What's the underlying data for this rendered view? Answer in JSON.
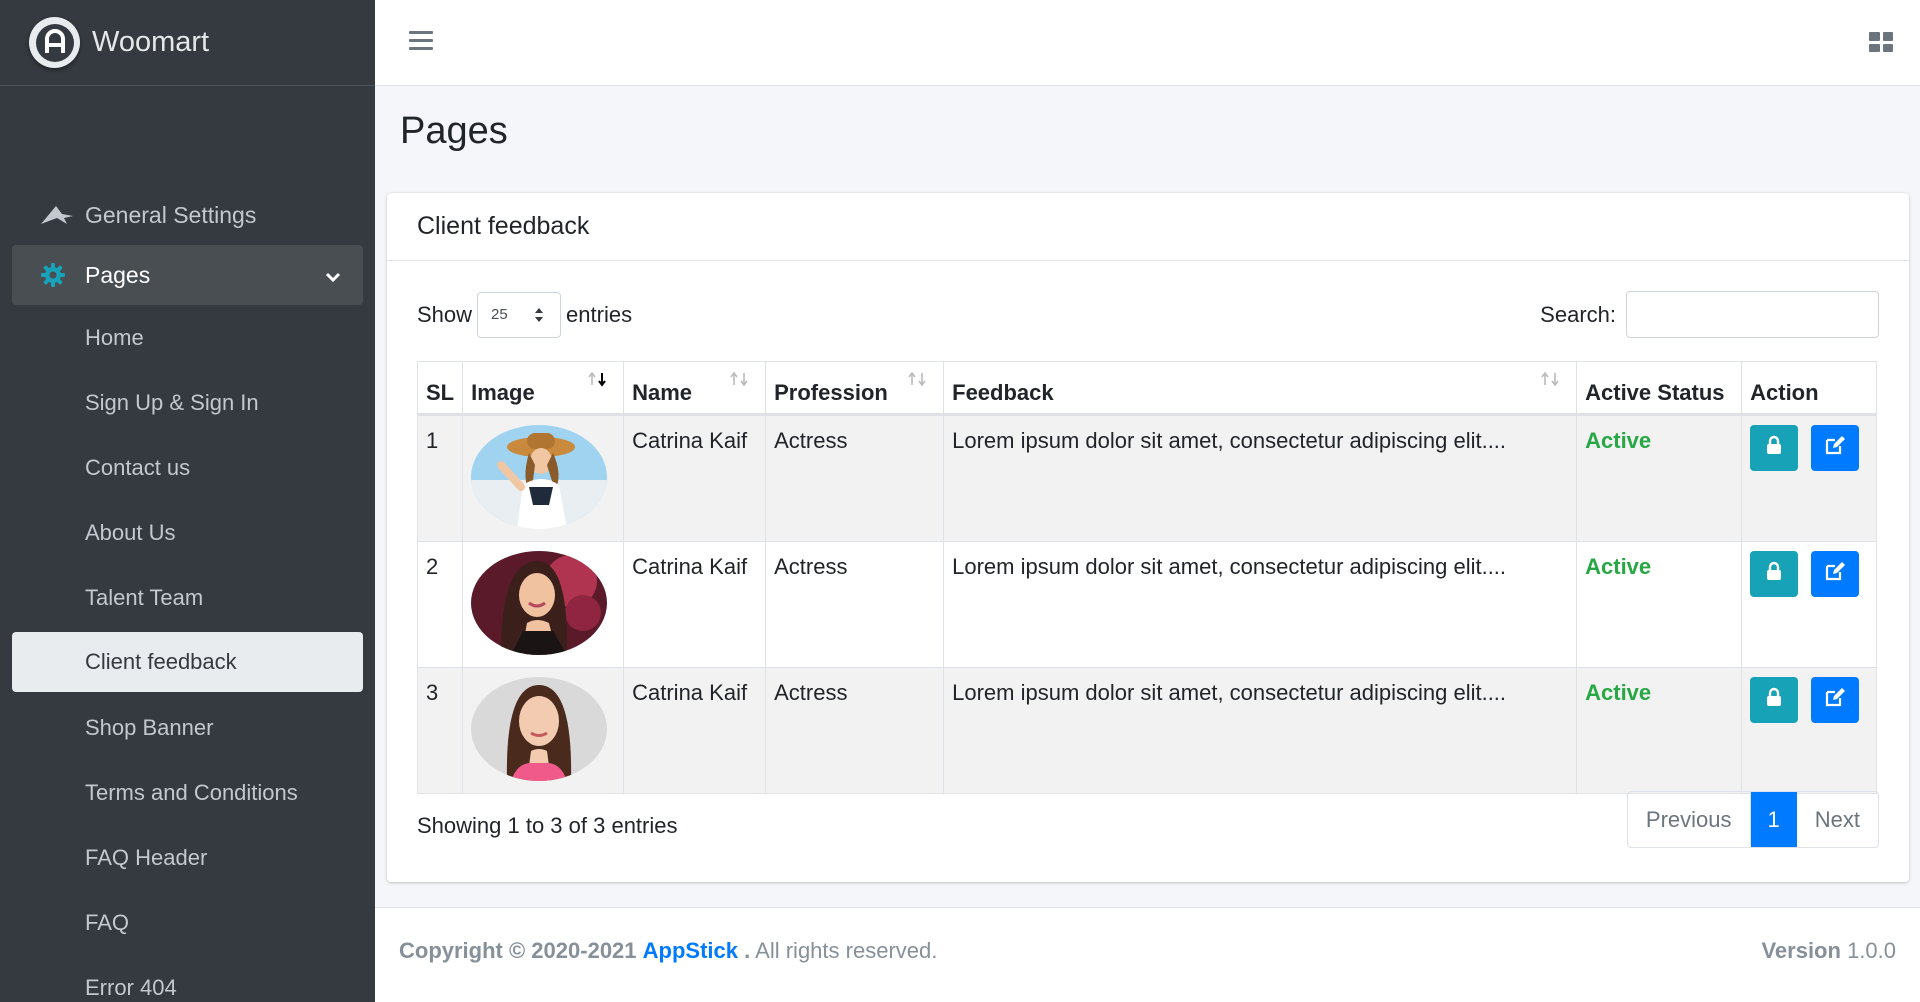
{
  "brand": {
    "name": "Woomart"
  },
  "sidebar": {
    "items": [
      {
        "label": "General Settings"
      },
      {
        "label": "Pages"
      }
    ],
    "sub_items": [
      {
        "label": "Home"
      },
      {
        "label": "Sign Up & Sign In"
      },
      {
        "label": "Contact us"
      },
      {
        "label": "About Us"
      },
      {
        "label": "Talent Team"
      },
      {
        "label": "Client feedback"
      },
      {
        "label": "Shop Banner"
      },
      {
        "label": "Terms and Conditions"
      },
      {
        "label": "FAQ Header"
      },
      {
        "label": "FAQ"
      },
      {
        "label": "Error 404"
      }
    ]
  },
  "page": {
    "title": "Pages"
  },
  "card": {
    "title": "Client feedback"
  },
  "table_controls": {
    "show_label": "Show",
    "entries_value": "25",
    "entries_label": "entries",
    "search_label": "Search:"
  },
  "table": {
    "headers": [
      "SL",
      "Image",
      "Name",
      "Profession",
      "Feedback",
      "Active Status",
      "Action"
    ],
    "rows": [
      {
        "sl": "1",
        "name": "Catrina Kaif",
        "profession": "Actress",
        "feedback": "Lorem ipsum dolor sit amet, consectetur adipiscing elit....",
        "status": "Active"
      },
      {
        "sl": "2",
        "name": "Catrina Kaif",
        "profession": "Actress",
        "feedback": "Lorem ipsum dolor sit amet, consectetur adipiscing elit....",
        "status": "Active"
      },
      {
        "sl": "3",
        "name": "Catrina Kaif",
        "profession": "Actress",
        "feedback": "Lorem ipsum dolor sit amet, consectetur adipiscing elit....",
        "status": "Active"
      }
    ]
  },
  "pagination": {
    "info": "Showing 1 to 3 of 3 entries",
    "previous": "Previous",
    "current": "1",
    "next": "Next"
  },
  "footer": {
    "copyright": "Copyright © 2020-2021",
    "company": "AppStick",
    "dot": ".",
    "rights": "All rights reserved.",
    "version_label": "Version",
    "version": "1.0.0"
  },
  "colors": {
    "sidebar_bg": "#343a40",
    "accent": "#007bff",
    "status_active": "#28a745",
    "info_button": "#17a2b8"
  },
  "icons": [
    "brand-logo-icon",
    "eagle-icon",
    "gear-icon",
    "chevron-down-icon",
    "hamburger-icon",
    "grid-icon",
    "sort-icon",
    "lock-icon",
    "edit-icon"
  ]
}
